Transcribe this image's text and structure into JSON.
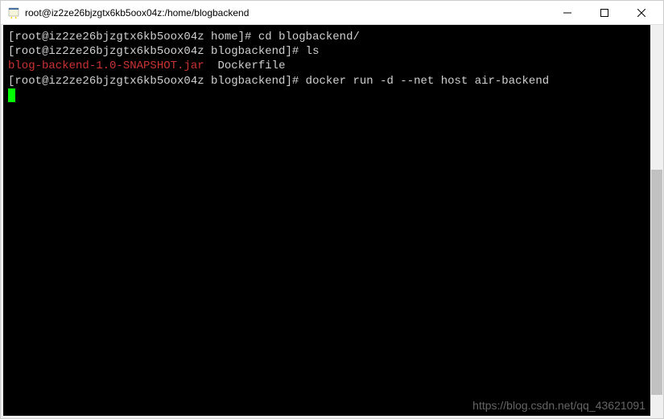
{
  "window": {
    "title": "root@iz2ze26bjzgtx6kb5oox04z:/home/blogbackend"
  },
  "terminal": {
    "lines": [
      {
        "prompt": "[root@iz2ze26bjzgtx6kb5oox04z home]# ",
        "command": "cd blogbackend/"
      },
      {
        "prompt": "[root@iz2ze26bjzgtx6kb5oox04z blogbackend]# ",
        "command": "ls"
      },
      {
        "file1": "blog-backend-1.0-SNAPSHOT.jar",
        "file2": "Dockerfile"
      },
      {
        "prompt": "[root@iz2ze26bjzgtx6kb5oox04z blogbackend]# ",
        "command": "docker run -d --net host air-backend"
      }
    ]
  },
  "watermark": "https://blog.csdn.net/qq_43621091"
}
